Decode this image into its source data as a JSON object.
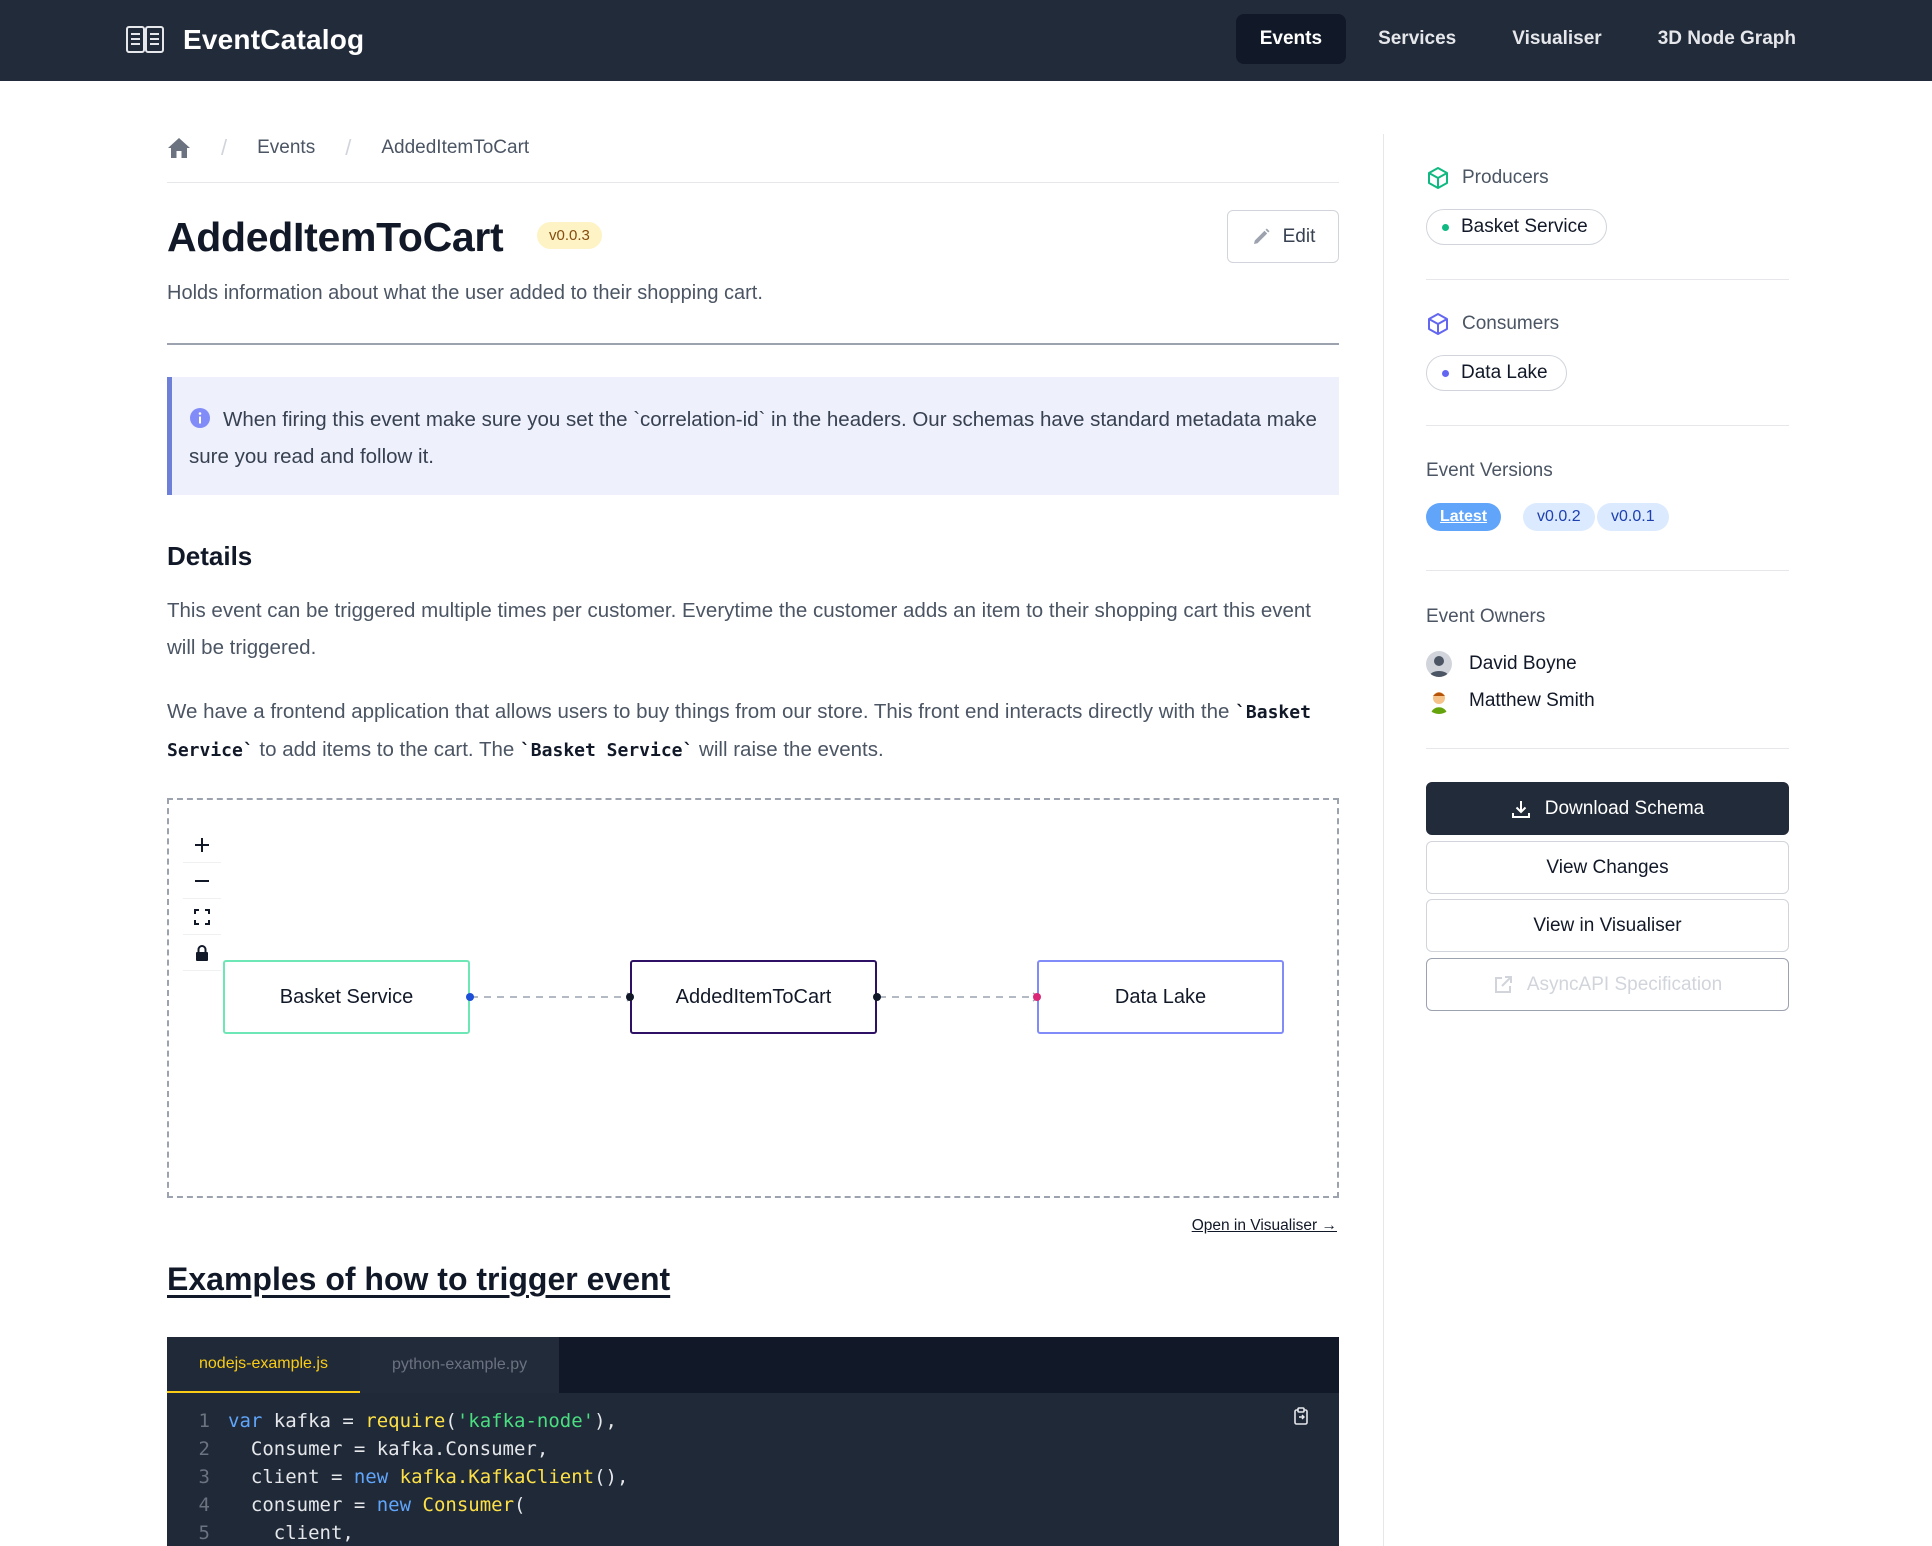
{
  "app": {
    "name": "EventCatalog"
  },
  "nav": {
    "items": [
      {
        "label": "Events",
        "active": true
      },
      {
        "label": "Services",
        "active": false
      },
      {
        "label": "Visualiser",
        "active": false
      },
      {
        "label": "3D Node Graph",
        "active": false
      }
    ]
  },
  "breadcrumb": {
    "items": [
      "Events",
      "AddedItemToCart"
    ],
    "separator": "/"
  },
  "event": {
    "title": "AddedItemToCart",
    "version": "v0.0.3",
    "summary": "Holds information about what the user added to their shopping cart.",
    "edit_label": "Edit"
  },
  "callout": {
    "text": "When firing this event make sure you set the `correlation-id` in the headers. Our schemas have standard metadata make sure you read and follow it."
  },
  "details": {
    "heading": "Details",
    "para1": "This event can be triggered multiple times per customer. Everytime the customer adds an item to their shopping cart this event will be triggered.",
    "para2_a": "We have a frontend application that allows users to buy things from our store. This front end interacts directly with the ",
    "para2_code1": "`Basket Service`",
    "para2_b": " to add items to the cart. The ",
    "para2_code2": "`Basket Service`",
    "para2_c": " will raise the events."
  },
  "flow": {
    "nodes": [
      {
        "label": "Basket Service",
        "border": "#6ee7b7"
      },
      {
        "label": "AddedItemToCart",
        "border": "#2e1065"
      },
      {
        "label": "Data Lake",
        "border": "#818cf8"
      }
    ],
    "controls": [
      "zoom-in",
      "zoom-out",
      "fit-view",
      "lock"
    ],
    "open_visualiser_label": "Open in Visualiser →"
  },
  "examples": {
    "heading": "Examples of how to trigger event",
    "tabs": [
      {
        "label": "nodejs-example.js",
        "active": true
      },
      {
        "label": "python-example.py",
        "active": false
      }
    ],
    "line_numbers": [
      "1",
      "2",
      "3",
      "4",
      "5"
    ]
  },
  "sidebar": {
    "producers": {
      "title": "Producers",
      "items": [
        "Basket Service"
      ],
      "dot_color": "#10b981"
    },
    "consumers": {
      "title": "Consumers",
      "items": [
        "Data Lake"
      ],
      "dot_color": "#6366f1"
    },
    "versions": {
      "title": "Event Versions",
      "items": [
        "Latest",
        "v0.0.2",
        "v0.0.1"
      ]
    },
    "owners": {
      "title": "Event Owners",
      "items": [
        "David Boyne",
        "Matthew Smith"
      ]
    },
    "buttons": {
      "download": "Download Schema",
      "changes": "View Changes",
      "visualiser": "View in Visualiser",
      "asyncapi": "AsyncAPI Specification"
    }
  },
  "colors": {
    "navbar": "#222b3a",
    "accent_yellow": "#facc15",
    "callout_border": "#6e7fd8"
  }
}
